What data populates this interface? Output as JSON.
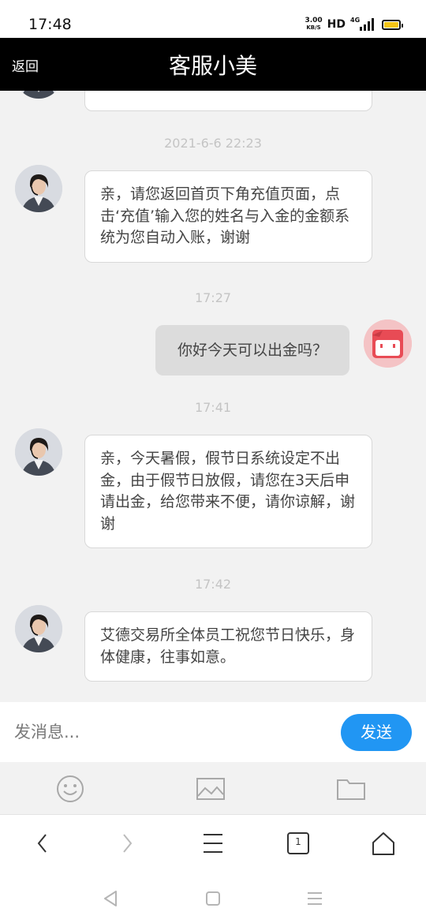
{
  "status_bar": {
    "time": "17:48",
    "net_speed_value": "3.00",
    "net_speed_unit": "KB/S",
    "hd": "HD",
    "network": "4G",
    "battery_color": "#f5c518"
  },
  "header": {
    "back_label": "返回",
    "title": "客服小美",
    "background": "#000000"
  },
  "messages": [
    {
      "timestamp": "2021-6-6 22:23"
    },
    {
      "text": "亲，请您返回首页下角充值页面，点击‘充值’输入您的姓名与入金的金额系统为您自动入账，谢谢"
    },
    {
      "timestamp": "17:27"
    },
    {
      "text": "你好今天可以出金吗？"
    },
    {
      "timestamp": "17:41"
    },
    {
      "text": "亲，今天暑假，假节日系统设定不出金，由于假节日放假，请您在3天后申请出金，给您带来不便，请你谅解，谢谢"
    },
    {
      "timestamp": "17:42"
    },
    {
      "text": "艾德交易所全体员工祝您节日快乐，身体健康，往事如意。"
    }
  ],
  "input": {
    "placeholder": "发消息...",
    "value": "",
    "send_label": "发送",
    "send_color": "#2196f3"
  },
  "toolbar": {
    "icons": [
      "emoji-icon",
      "image-icon",
      "folder-icon"
    ]
  },
  "browser_nav": {
    "tab_count": "1",
    "icons": [
      "back-arrow-icon",
      "forward-arrow-icon",
      "menu-icon",
      "tabs-icon",
      "home-icon"
    ]
  },
  "system_nav": {
    "icons": [
      "back-triangle-icon",
      "home-square-icon",
      "recents-icon"
    ]
  }
}
